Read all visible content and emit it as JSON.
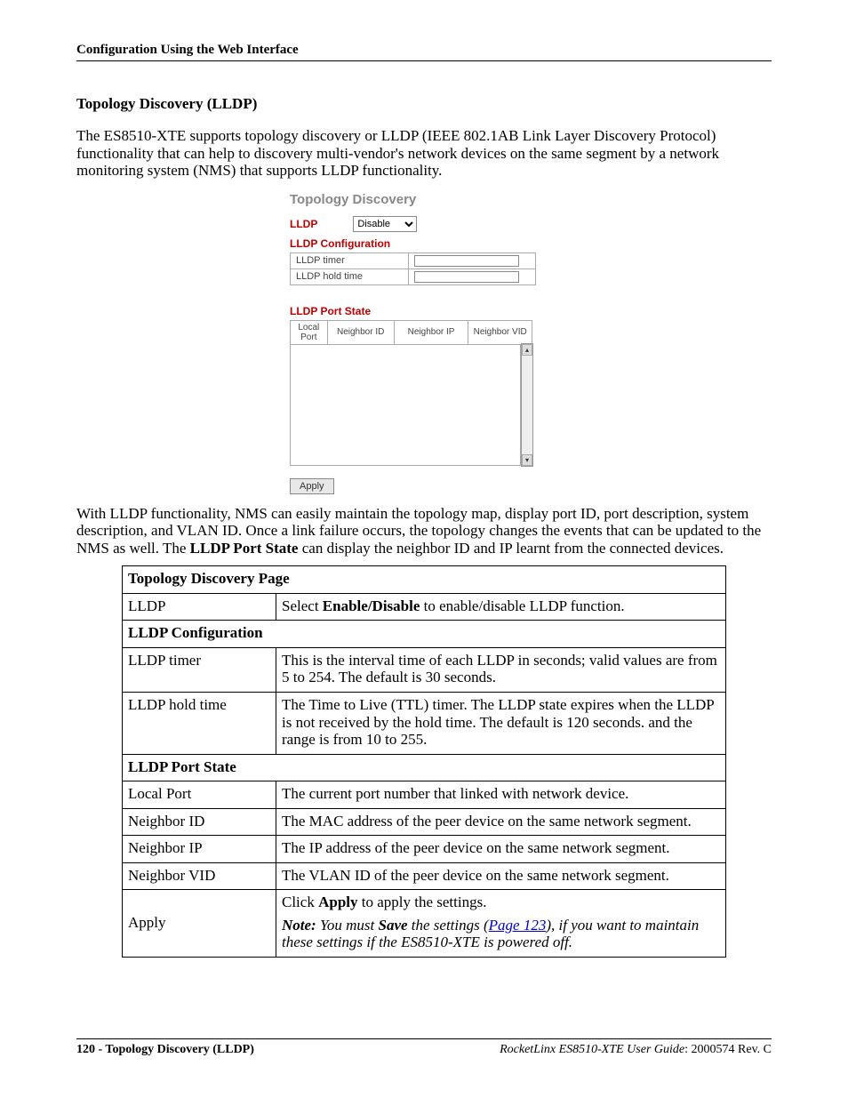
{
  "header": "Configuration Using the Web Interface",
  "section_title": "Topology Discovery (LLDP)",
  "intro": "The ES8510-XTE supports topology discovery or LLDP (IEEE 802.1AB Link Layer Discovery Protocol) functionality that can help to discovery multi-vendor's network devices on the same segment by a network monitoring system (NMS) that supports LLDP functionality.",
  "ui": {
    "title": "Topology Discovery",
    "lldp_label": "LLDP",
    "lldp_select_value": "Disable",
    "config_header": "LLDP Configuration",
    "rows": {
      "timer": "LLDP timer",
      "hold": "LLDP hold time"
    },
    "portstate_header": "LLDP Port State",
    "ps_cols": {
      "c1": "Local Port",
      "c2": "Neighbor ID",
      "c3": "Neighbor IP",
      "c4": "Neighbor VID"
    },
    "apply": "Apply"
  },
  "para2_a": "With LLDP functionality, NMS can easily maintain the topology map, display port ID, port description, system description, and VLAN ID. Once a link failure occurs, the topology changes the events that can be updated to the NMS as well. The ",
  "para2_b": "LLDP Port State",
  "para2_c": " can display the neighbor ID and IP learnt from the connected devices.",
  "table": {
    "title": "Topology Discovery Page",
    "lldp": {
      "label": "LLDP",
      "desc_a": "Select ",
      "desc_b": "Enable/Disable",
      "desc_c": " to enable/disable LLDP function."
    },
    "cfg_header": "LLDP Configuration",
    "timer": {
      "label": "LLDP timer",
      "desc": "This is the interval time of each LLDP in seconds; valid values are from 5 to 254. The default is 30 seconds."
    },
    "hold": {
      "label": "LLDP hold time",
      "desc": "The Time to Live (TTL) timer. The LLDP state expires when the LLDP is not received by the hold time. The default is 120 seconds. and the range is from 10 to 255."
    },
    "ps_header": "LLDP Port State",
    "local": {
      "label": "Local Port",
      "desc": "The current port number that linked with network device."
    },
    "nid": {
      "label": "Neighbor ID",
      "desc": "The MAC address of the peer device on the same network segment."
    },
    "nip": {
      "label": "Neighbor IP",
      "desc": "The IP address of the peer device on the same network segment."
    },
    "nvid": {
      "label": "Neighbor VID",
      "desc": "The VLAN ID of the peer device on the same network segment."
    },
    "apply": {
      "label": "Apply",
      "line1_a": "Click ",
      "line1_b": "Apply",
      "line1_c": " to apply the settings.",
      "note_label": "Note:",
      "note_a": " You must ",
      "note_b": "Save",
      "note_c": " the settings (",
      "note_link": "Page 123",
      "note_d": "), if you want to maintain these settings if the ES8510-XTE is powered off."
    }
  },
  "footer": {
    "left": "120 - Topology Discovery (LLDP)",
    "right_it": "RocketLinx ES8510-XTE User Guide",
    "right_rest": ": 2000574 Rev. C"
  }
}
